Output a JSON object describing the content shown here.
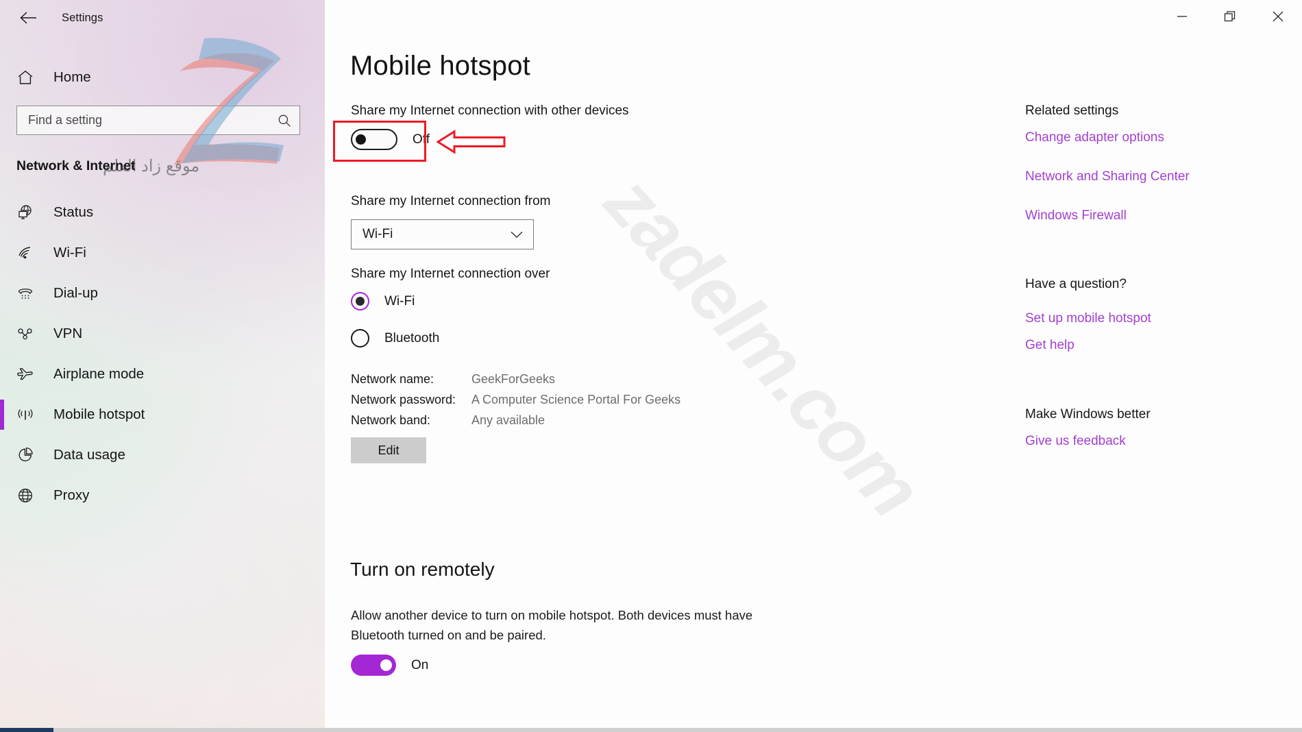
{
  "window": {
    "app_title": "Settings",
    "back_icon": "back-arrow-icon",
    "controls": {
      "minimize": "minimize-icon",
      "restore": "restore-icon",
      "close": "close-icon"
    }
  },
  "sidebar": {
    "home_label": "Home",
    "search": {
      "placeholder": "Find a setting",
      "value": ""
    },
    "category_title": "Network & Internet",
    "items": [
      {
        "label": "Status",
        "icon": "globe-monitor-icon",
        "selected": false
      },
      {
        "label": "Wi-Fi",
        "icon": "wifi-icon",
        "selected": false
      },
      {
        "label": "Dial-up",
        "icon": "dialup-phone-icon",
        "selected": false
      },
      {
        "label": "VPN",
        "icon": "vpn-key-icon",
        "selected": false
      },
      {
        "label": "Airplane mode",
        "icon": "airplane-icon",
        "selected": false
      },
      {
        "label": "Mobile hotspot",
        "icon": "hotspot-icon",
        "selected": true
      },
      {
        "label": "Data usage",
        "icon": "pie-chart-icon",
        "selected": false
      },
      {
        "label": "Proxy",
        "icon": "globe-icon",
        "selected": false
      }
    ]
  },
  "main": {
    "page_title": "Mobile hotspot",
    "share_with_label": "Share my Internet connection with other devices",
    "share_toggle_state": "Off",
    "share_from_label": "Share my Internet connection from",
    "share_from_value": "Wi-Fi",
    "share_over_label": "Share my Internet connection over",
    "radio_options": [
      {
        "label": "Wi-Fi",
        "checked": true
      },
      {
        "label": "Bluetooth",
        "checked": false
      }
    ],
    "details": [
      {
        "key": "Network name:",
        "value": "GeekForGeeks"
      },
      {
        "key": "Network password:",
        "value": "A Computer Science Portal For Geeks"
      },
      {
        "key": "Network band:",
        "value": "Any available"
      }
    ],
    "edit_button": "Edit",
    "remote_section": {
      "title": "Turn on remotely",
      "description": "Allow another device to turn on mobile hotspot. Both devices must have Bluetooth turned on and be paired.",
      "toggle_state": "On"
    }
  },
  "right_column": {
    "related_settings_head": "Related settings",
    "related_links": [
      "Change adapter options",
      "Network and Sharing Center",
      "Windows Firewall"
    ],
    "question_head": "Have a question?",
    "question_links": [
      "Set up mobile hotspot",
      "Get help"
    ],
    "feedback_head": "Make Windows better",
    "feedback_links": [
      "Give us feedback"
    ]
  },
  "watermark": {
    "diagonal_text": "zadelm.com",
    "arabic_text": "موقع زاد العلم",
    "logo": "z-logo-watermark"
  },
  "colors": {
    "accent_purple": "#a425d6",
    "link_purple": "#a33fd1",
    "annotation_red": "#ee1a24",
    "toggle_on": "#a427d4"
  }
}
